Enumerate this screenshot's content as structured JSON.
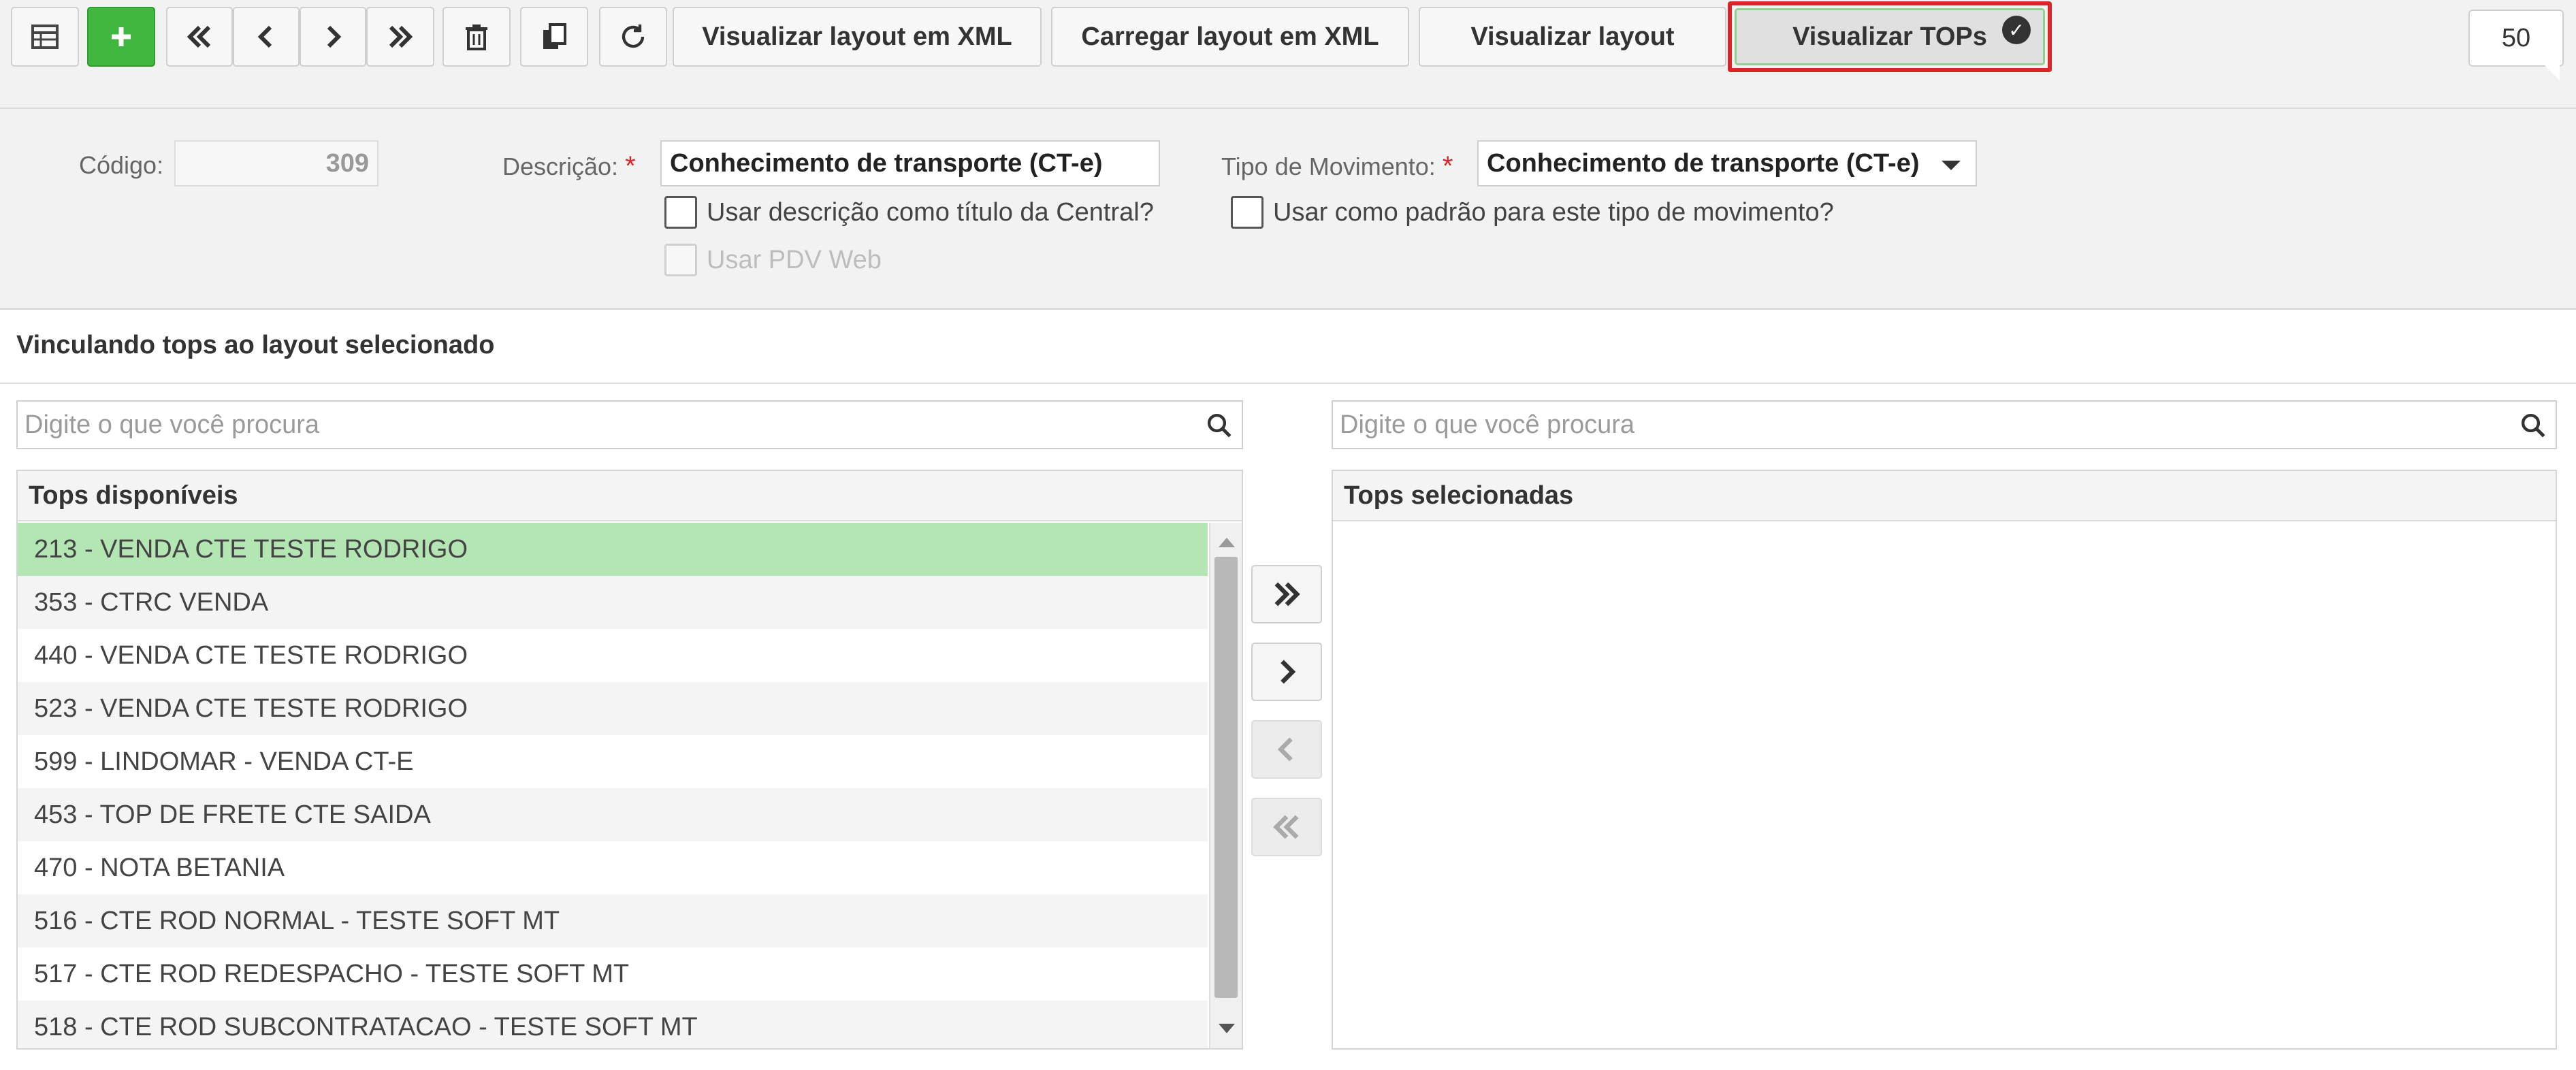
{
  "toolbar": {
    "buttons": {
      "grid": {
        "icon": "grid-icon"
      },
      "add": {
        "icon": "plus-icon",
        "color": "#40b840"
      },
      "first": {
        "icon": "double-chevron-left-icon"
      },
      "prev": {
        "icon": "chevron-left-icon"
      },
      "next": {
        "icon": "chevron-right-icon"
      },
      "last": {
        "icon": "double-chevron-right-icon"
      },
      "delete": {
        "icon": "trash-icon"
      },
      "duplicate": {
        "icon": "copy-icon"
      },
      "refresh": {
        "icon": "refresh-icon"
      }
    },
    "view_xml_label": "Visualizar layout em XML",
    "load_xml_label": "Carregar layout em XML",
    "view_layout_label": "Visualizar layout",
    "view_tops_label": "Visualizar TOPs",
    "page_size": "50",
    "highlight_color": "#d92626"
  },
  "form": {
    "codigo_label": "Código:",
    "codigo_value": "309",
    "descricao_label": "Descrição:",
    "descricao_value": "Conhecimento de transporte (CT-e)",
    "required_mark": "*",
    "tipo_label": "Tipo de Movimento:",
    "tipo_value": "Conhecimento de transporte (CT-e)",
    "chk_titulo_label": "Usar descrição como título da Central?",
    "chk_padrao_label": "Usar como padrão para este tipo de movimento?",
    "chk_pdv_label": "Usar PDV Web"
  },
  "section": {
    "title": "Vinculando tops ao layout selecionado",
    "search_placeholder": "Digite o que você procura",
    "available_title": "Tops disponíveis",
    "selected_title": "Tops selecionadas",
    "available_items": [
      "213 - VENDA CTE TESTE RODRIGO",
      "353 - CTRC VENDA",
      "440 - VENDA CTE TESTE RODRIGO",
      "523 - VENDA CTE TESTE RODRIGO",
      "599 - LINDOMAR - VENDA CT-E",
      "453 - TOP DE FRETE CTE SAIDA",
      "470 - NOTA BETANIA",
      "516 - CTE ROD NORMAL - TESTE SOFT MT",
      "517 - CTE ROD REDESPACHO - TESTE SOFT MT",
      "518 - CTE ROD SUBCONTRATACAO - TESTE SOFT MT"
    ],
    "selected_items": [],
    "selected_row_color": "#b3e6b3"
  }
}
